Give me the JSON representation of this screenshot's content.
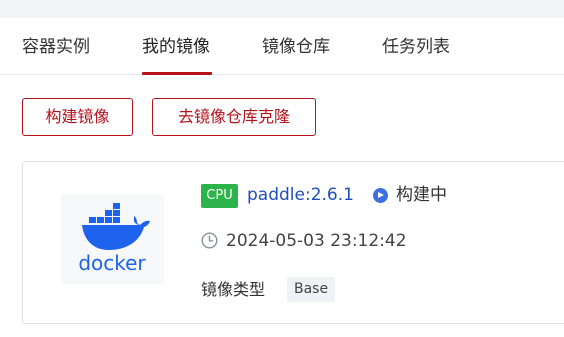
{
  "tabs": [
    {
      "label": "容器实例"
    },
    {
      "label": "我的镜像"
    },
    {
      "label": "镜像仓库"
    },
    {
      "label": "任务列表"
    }
  ],
  "active_tab": "我的镜像",
  "actions": {
    "build_label": "构建镜像",
    "clone_label": "去镜像仓库克隆"
  },
  "image_card": {
    "logo_text": "docker",
    "logo_icon": "docker-whale-icon",
    "hardware_badge": "CPU",
    "name": "paddle:2.6.1",
    "status": "构建中",
    "status_icon": "play-circle-icon",
    "created_at": "2024-05-03 23:12:42",
    "type_label": "镜像类型",
    "type_value": "Base"
  },
  "colors": {
    "accent": "#b5121b",
    "cpu_badge": "#2cb34a",
    "link": "#1f4fbf",
    "status_icon": "#3d6fe0",
    "docker_blue": "#1d63ed"
  }
}
